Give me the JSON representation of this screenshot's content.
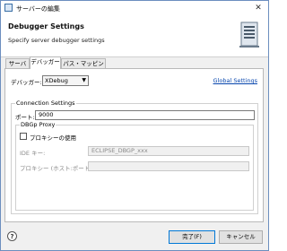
{
  "window": {
    "title": "サーバーの編集",
    "close_glyph": "✕"
  },
  "header": {
    "title": "Debugger Settings",
    "subtitle": "Specify server debugger settings"
  },
  "tabs": [
    {
      "label": "サーバー"
    },
    {
      "label": "デバッガー",
      "active": true
    },
    {
      "label": "パス・マッピング"
    }
  ],
  "debugger": {
    "label": "デバッガー:",
    "selected": "XDebug",
    "link": "Global Settings"
  },
  "connection": {
    "title": "Connection Settings",
    "port_label": "ポート:",
    "port_value": "9000"
  },
  "dbgp": {
    "title": "DBGp Proxy",
    "use_proxy_label": "プロキシーの使用",
    "use_proxy_checked": false,
    "ide_key_label": "IDE キー:",
    "ide_key_value": "ECLIPSE_DBGP_xxx",
    "proxy_label": "プロキシー (ホスト:ポート):",
    "proxy_value": ""
  },
  "footer": {
    "help": "?",
    "finish": "完了(F)",
    "cancel": "キャンセル"
  },
  "colors": {
    "link": "#0645ad",
    "window_border": "#6c8ebf",
    "default_button_border": "#0078d7"
  }
}
